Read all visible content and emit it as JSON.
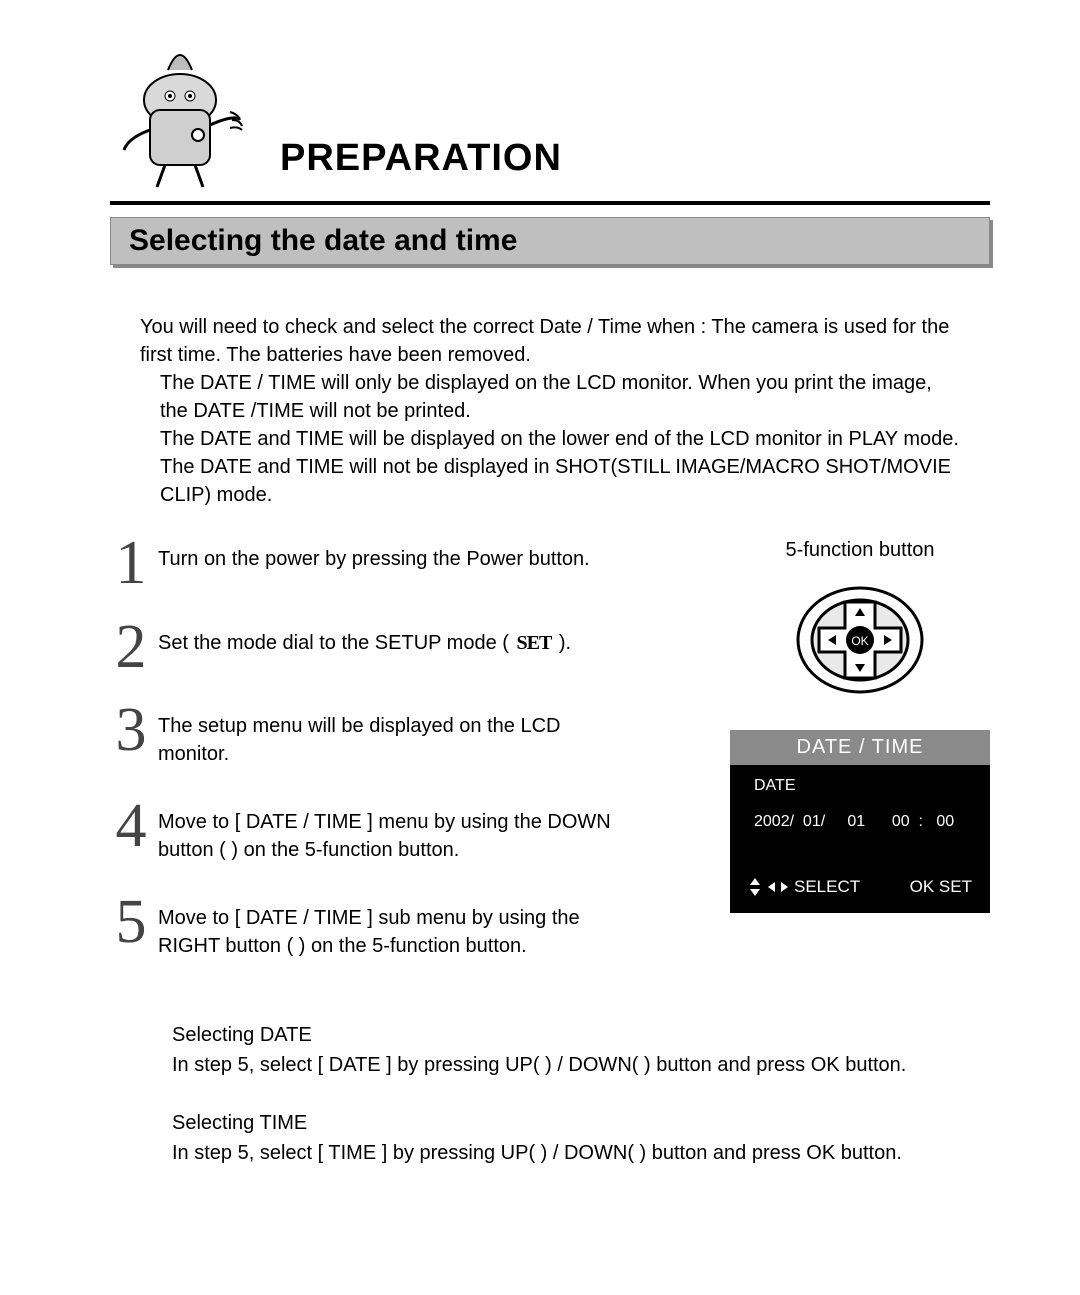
{
  "header": {
    "title": "PREPARATION"
  },
  "section": {
    "title": "Selecting the date and time"
  },
  "intro": {
    "line1": "You will need to check and select the correct Date / Time when : The camera is used for the first time. The batteries have been removed.",
    "sub1": "The DATE / TIME will only be displayed on the LCD monitor. When you print the image, the DATE /TIME will not be printed.",
    "sub2": "The DATE and TIME will be displayed on the lower end of the LCD monitor in PLAY mode.",
    "sub3": "The DATE and TIME will not be displayed in SHOT(STILL IMAGE/MACRO SHOT/MOVIE CLIP) mode."
  },
  "steps": {
    "n1": "1",
    "t1": "Turn on the power by pressing the Power button.",
    "n2": "2",
    "t2a": "Set the mode dial to the SETUP mode (  ",
    "set_glyph": "SET",
    "t2b": "  ).",
    "n3": "3",
    "t3": "The setup menu will be displayed on the LCD monitor.",
    "n4": "4",
    "t4": "Move to [ DATE / TIME ] menu by using the DOWN button (       ) on the 5-function button.",
    "n5": "5",
    "t5": "Move to [ DATE / TIME ] sub menu by using the RIGHT button (       ) on the 5-function button."
  },
  "right": {
    "caption": "5-function button",
    "ok": "OK"
  },
  "lcd": {
    "title": "DATE / TIME",
    "date_label": "DATE",
    "vals": "2002/  01/     01      00  :   00",
    "select": "SELECT",
    "okset": "OK SET"
  },
  "after": {
    "date_h": "Selecting DATE",
    "date_t": "In step 5, select [ DATE ] by pressing UP(       ) / DOWN(       ) button and press OK button.",
    "time_h": "Selecting TIME",
    "time_t": "In step 5, select [ TIME ] by pressing UP(       ) / DOWN(       ) button and press OK button."
  }
}
